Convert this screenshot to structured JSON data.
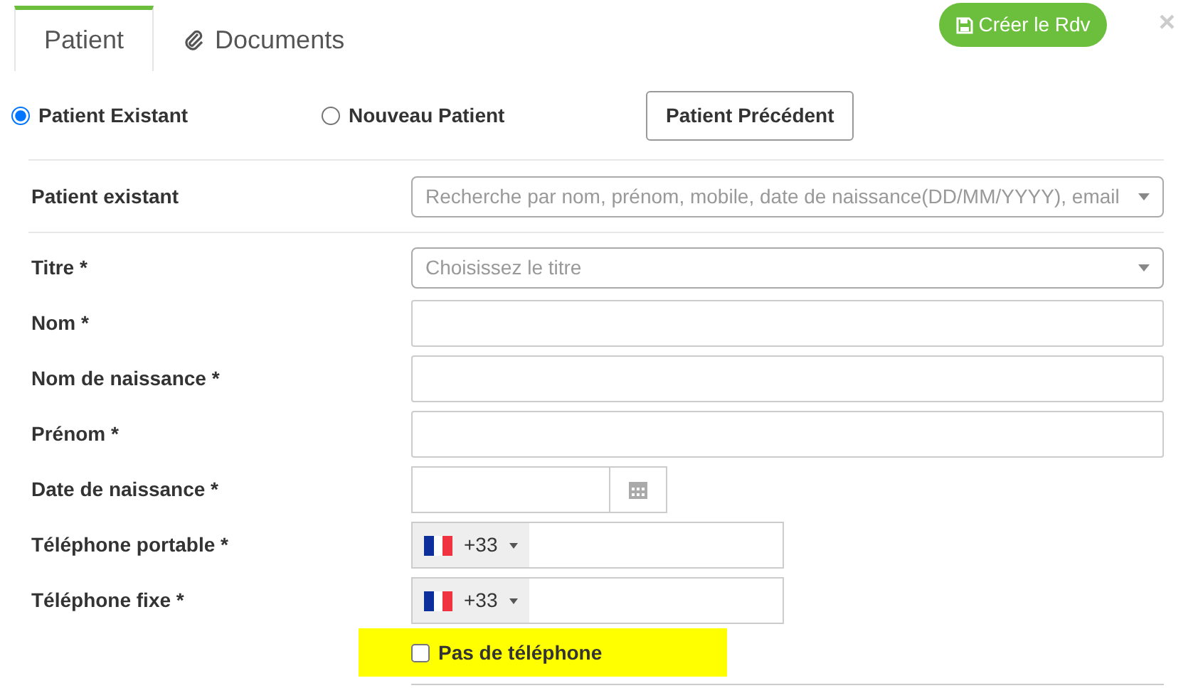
{
  "tabs": [
    {
      "label": "Patient",
      "selected": true,
      "kind": "plain"
    },
    {
      "label": "Documents",
      "selected": false,
      "kind": "attachment"
    }
  ],
  "create_button": "Créer le Rdv",
  "close": "×",
  "patient_type": [
    {
      "label": "Patient Existant",
      "selected": true
    },
    {
      "label": "Nouveau Patient",
      "selected": false
    }
  ],
  "previous_button": "Patient Précédent",
  "search": {
    "label": "Patient existant",
    "placeholder": "Recherche par nom, prénom, mobile, date de naissance(DD/MM/YYYY), email"
  },
  "fields": [
    {
      "label": "Titre *",
      "kind": "select",
      "placeholder": "Choisissez le titre"
    },
    {
      "label": "Nom *",
      "kind": "text"
    },
    {
      "label": "Nom de naissance *",
      "kind": "text"
    },
    {
      "label": "Prénom *",
      "kind": "text"
    },
    {
      "label": "Date de naissance *",
      "kind": "date"
    },
    {
      "label": "Téléphone portable *",
      "kind": "phone",
      "dial_code": "+33"
    },
    {
      "label": "Téléphone fixe *",
      "kind": "phone",
      "dial_code": "+33"
    }
  ],
  "no_phone": {
    "label": "Pas de téléphone",
    "checked": false
  }
}
